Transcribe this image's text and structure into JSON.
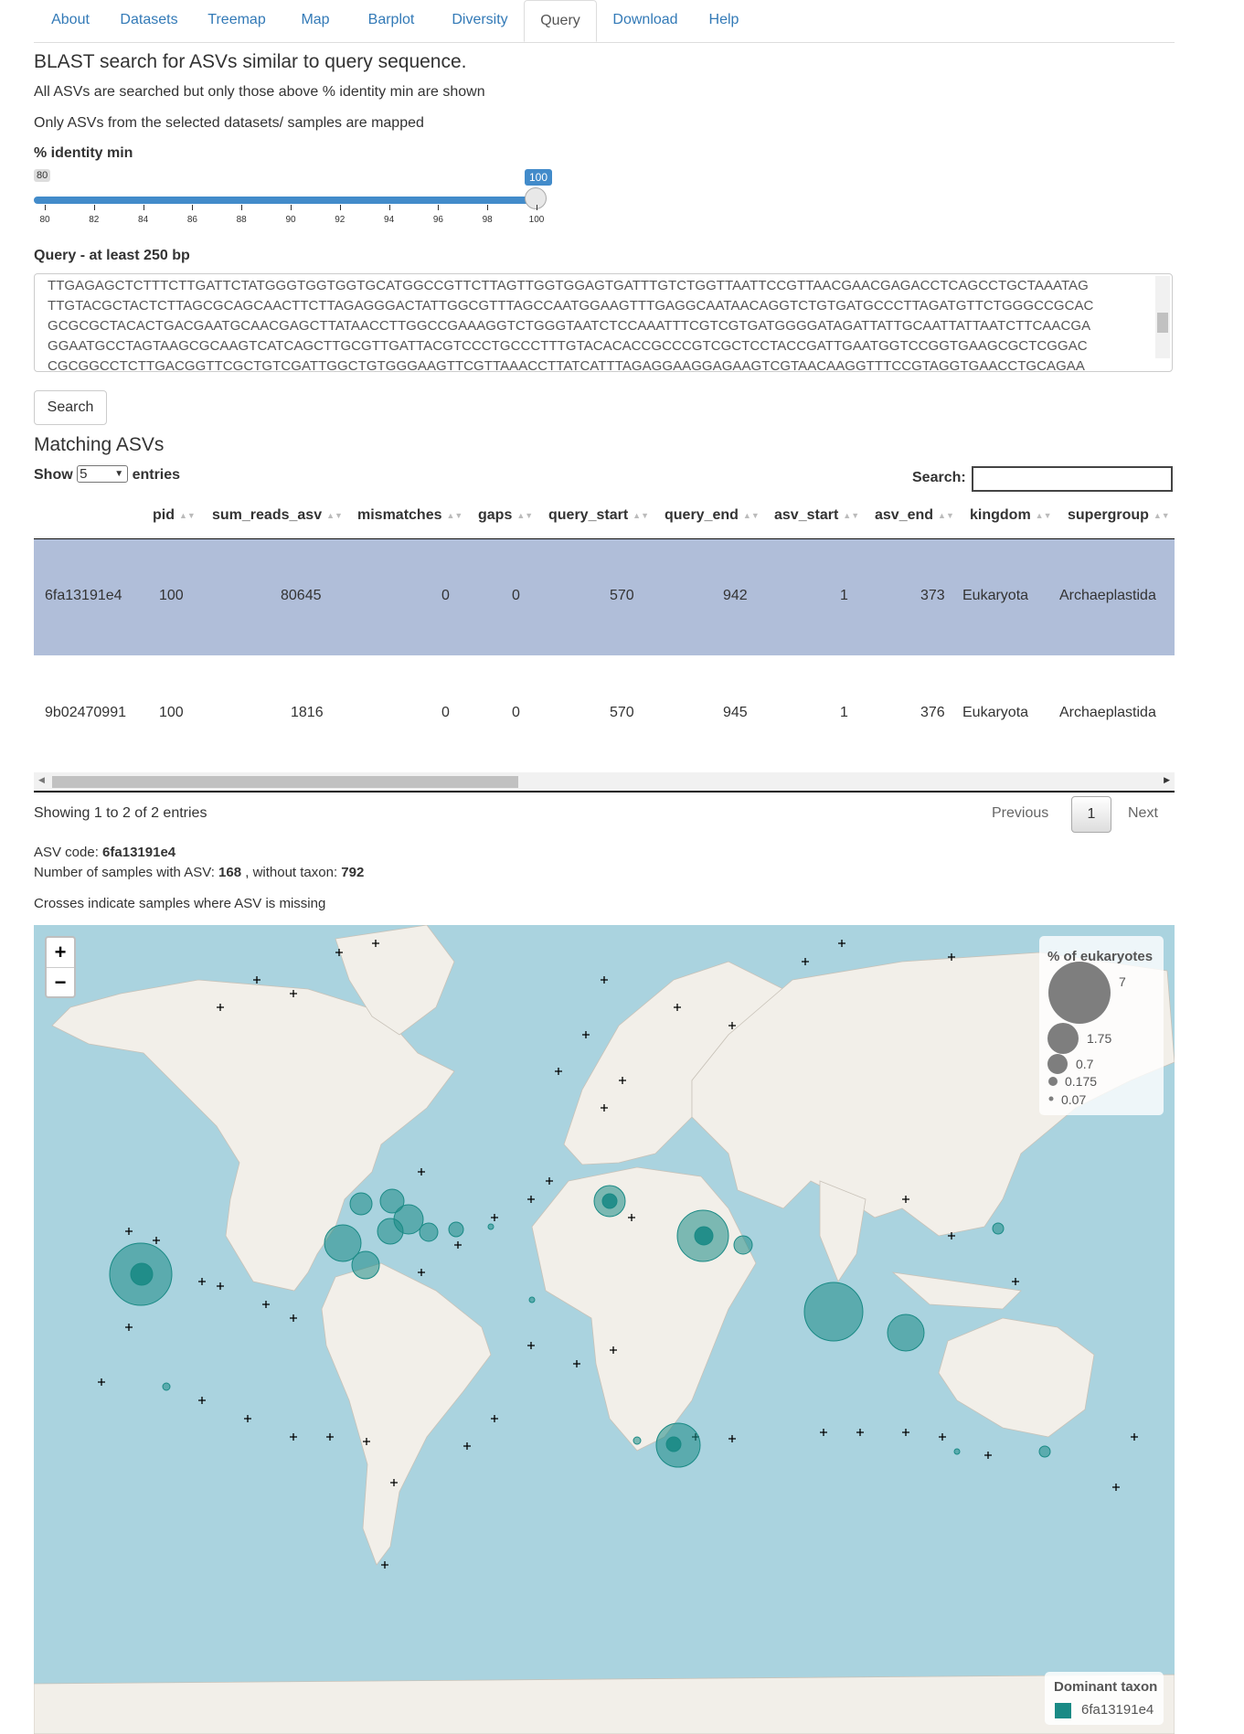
{
  "tabs": [
    "About",
    "Datasets",
    "Treemap",
    "Map",
    "Barplot",
    "Diversity",
    "Query",
    "Download",
    "Help"
  ],
  "active_tab": "Query",
  "heading": "BLAST search for ASVs similar to query sequence.",
  "info1": "All ASVs are searched but only those above % identity min are shown",
  "info2": "Only ASVs from the selected datasets/ samples are mapped",
  "slider": {
    "label": "% identity min",
    "min": 80,
    "max": 100,
    "value": 100,
    "min_label": "80",
    "value_label": "100",
    "ticks": [
      "80",
      "82",
      "84",
      "86",
      "88",
      "90",
      "92",
      "94",
      "96",
      "98",
      "100"
    ]
  },
  "query": {
    "label": "Query - at least 250 bp",
    "lines": [
      "TTGAGAGCTCTTTCTTGATTCTATGGGTGGTGGTGCATGGCCGTTCTTAGTTGGTGGAGTGATTTGTCTGGTTAATTCCGTTAACGAACGAGACCTCAGCCTGCTAAATAG",
      "TTGTACGCTACTCTTAGCGCAGCAACTTCTTAGAGGGACTATTGGCGTTTAGCCAATGGAAGTTTGAGGCAATAACAGGTCTGTGATGCCCTTAGATGTTCTGGGCCGCAC",
      "GCGCGCTACACTGACGAATGCAACGAGCTTATAACCTTGGCCGAAAGGTCTGGGTAATCTCCAAATTTCGTCGTGATGGGGATAGATTATTGCAATTATTAATCTTCAACGA",
      "GGAATGCCTAGTAAGCGCAAGTCATCAGCTTGCGTTGATTACGTCCCTGCCCTTTGTACACACCGCCCGTCGCTCCTACCGATTGAATGGTCCGGTGAAGCGCTCGGAC",
      "CGCGGCCTCTTGACGGTTCGCTGTCGATTGGCTGTGGGAAGTTCGTTAAACCTTATCATTTAGAGGAAGGAGAAGTCGTAACAAGGTTTCCGTAGGTGAACCTGCAGAA"
    ]
  },
  "search_button": "Search",
  "matching_title": "Matching ASVs",
  "show": {
    "prefix": "Show",
    "value": "5",
    "suffix": "entries"
  },
  "search_label": "Search:",
  "table": {
    "columns": [
      "",
      "pid",
      "sum_reads_asv",
      "mismatches",
      "gaps",
      "query_start",
      "query_end",
      "asv_start",
      "asv_end",
      "kingdom",
      "supergroup"
    ],
    "rows": [
      [
        "6fa13191e4",
        "100",
        "80645",
        "0",
        "0",
        "570",
        "942",
        "1",
        "373",
        "Eukaryota",
        "Archaeplastida"
      ],
      [
        "9b02470991",
        "100",
        "1816",
        "0",
        "0",
        "570",
        "945",
        "1",
        "376",
        "Eukaryota",
        "Archaeplastida"
      ]
    ]
  },
  "showing": "Showing 1 to 2 of 2 entries",
  "pager": {
    "prev": "Previous",
    "page": "1",
    "next": "Next"
  },
  "asv": {
    "code_label": "ASV code: ",
    "code": "6fa13191e4",
    "samples_label": "Number of samples with ASV: ",
    "samples": "168",
    "without_label": " , without taxon: ",
    "without": "792"
  },
  "crosses_note": "Crosses indicate samples where ASV is missing",
  "map": {
    "zoom_in": "+",
    "zoom_out": "−",
    "legend_title": "% of eukaryotes",
    "legend_values": [
      "7",
      "1.75",
      "0.7",
      "0.175",
      "0.07"
    ],
    "taxon_title": "Dominant taxon",
    "taxon_label": "6fa13191e4",
    "colors": {
      "ocean": "#aad3df",
      "land": "#f2efe9",
      "circle": "#1a8a85",
      "legend_circle": "#777777"
    }
  }
}
